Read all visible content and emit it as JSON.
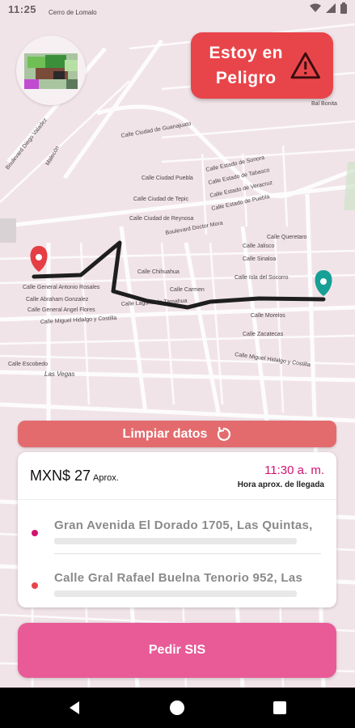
{
  "status_bar": {
    "time": "11:25"
  },
  "panic_button": {
    "label": "Estoy en Peligro",
    "icon": "warning-triangle-icon"
  },
  "clear_button": {
    "label": "Limpiar datos",
    "icon": "refresh-icon"
  },
  "trip_card": {
    "price": "MXN$ 27",
    "price_note": "Aprox.",
    "eta_time": "11:30 a.  m.",
    "eta_label": "Hora aprox. de llegada",
    "origin": "Gran Avenida El Dorado 1705, Las Quintas,",
    "destination": "Calle Gral Rafael Buelna Tenorio 952, Las"
  },
  "request_button": {
    "label": "Pedir SIS"
  },
  "map": {
    "labels": {
      "cerro": "Cerro de Lomalo",
      "diego": "Boulevard Diego Valadez",
      "malecon": "Malecón",
      "doctor_mora": "Boulevard Doctor Mora",
      "hidalgo": "Calle Miguel Hidalgo y Costilla",
      "hidalgo2": "Calle Miguel Hidalgo y Costilla",
      "vegas": "Las Vegas",
      "escobedo": "Calle Escobedo",
      "bonita": "Bal Bonita",
      "laguna": "Calle Laguna de Tamahua",
      "carmen": "Calle Carmen",
      "isla": "Calle Isla del Socorro",
      "sinaloa": "Calle Sinaloa",
      "jalisco": "Calle Jalisco",
      "zacatecas": "Calle Zacatecas",
      "morelos": "Calle Morelos",
      "chihuahua": "Calle Chihuahua",
      "sonora": "Calle Estado de Sonora",
      "tabasco": "Calle Estado de Tabasco",
      "veracruz": "Calle Estado de Veracruz",
      "puebla": "Calle Estado de Puebla",
      "queretaro": "Calle Queretaro",
      "guanajuato": "Calle Ciudad de Guanajuato",
      "puebla_c": "Calle Ciudad Puebla",
      "reynosa": "Calle Ciudad de Reynosa",
      "tepic": "Calle Ciudad de Tepic",
      "rosales": "Calle General Antonio Rosales",
      "abraham": "Calle Abraham Gonzalez",
      "flores": "Calle General Angel Flores"
    }
  },
  "colors": {
    "panic": "#e8454a",
    "clear": "#e36b6e",
    "request": "#e85b97",
    "eta": "#d2136f",
    "origin_dot": "#d2136f",
    "destination_dot": "#e8454a",
    "origin_pin": "#e53e45",
    "destination_pin": "#17a096",
    "route": "#1e1e1e"
  },
  "icons": [
    "wifi-icon",
    "signal-icon",
    "battery-icon",
    "back-icon",
    "home-icon",
    "recents-icon"
  ]
}
